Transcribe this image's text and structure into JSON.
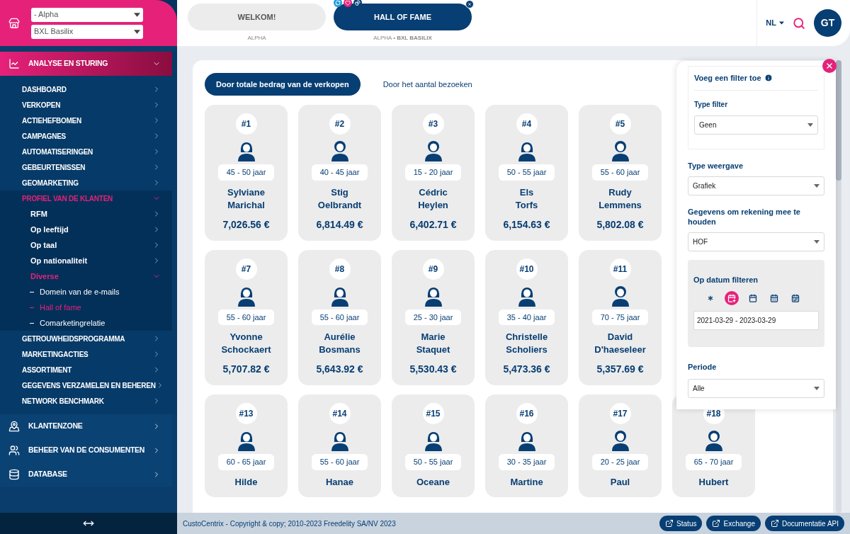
{
  "sidebar": {
    "selects": [
      "- Alpha",
      "BXL Basilix"
    ],
    "sections": [
      {
        "label": "ANALYSE EN STURING",
        "kind": "chart",
        "expanded": true,
        "selected": true,
        "items": [
          {
            "label": "DASHBOARD",
            "selected": false,
            "expanded": false
          },
          {
            "label": "VERKOPEN",
            "selected": false,
            "expanded": false
          },
          {
            "label": "ACTIEHEFBOMEN",
            "selected": false,
            "expanded": false
          },
          {
            "label": "CAMPAGNES",
            "selected": false,
            "expanded": false
          },
          {
            "label": "AUTOMATISERINGEN",
            "selected": false,
            "expanded": false
          },
          {
            "label": "GEBEURTENISSEN",
            "selected": false,
            "expanded": false
          },
          {
            "label": "GEOMARKETING",
            "selected": false,
            "expanded": false
          },
          {
            "label": "PROFIEL VAN DE KLANTEN",
            "selected": true,
            "expanded": true,
            "children": [
              {
                "label": "RFM",
                "selected": false,
                "expanded": false
              },
              {
                "label": "Op leeftijd",
                "selected": false,
                "expanded": false
              },
              {
                "label": "Op taal",
                "selected": false,
                "expanded": false
              },
              {
                "label": "Op nationaliteit",
                "selected": false,
                "expanded": false
              },
              {
                "label": "Diverse",
                "selected": true,
                "expanded": true,
                "children": [
                  {
                    "label": "Domein van de e-mails",
                    "selected": false
                  },
                  {
                    "label": "Hall of fame",
                    "selected": true
                  },
                  {
                    "label": "Comarketingrelatie",
                    "selected": false
                  }
                ]
              }
            ]
          },
          {
            "label": "GETROUWHEIDSPROGRAMMA",
            "selected": false,
            "expanded": false
          },
          {
            "label": "MARKETINGACTIES",
            "selected": false,
            "expanded": false
          },
          {
            "label": "ASSORTIMENT",
            "selected": false,
            "expanded": false
          },
          {
            "label": "GEGEVENS VERZAMELEN EN BEHEREN",
            "selected": false,
            "expanded": false
          },
          {
            "label": "NETWORK BENCHMARK",
            "selected": false,
            "expanded": false
          }
        ]
      },
      {
        "label": "KLANTENZONE",
        "kind": "map",
        "expanded": false,
        "selected": false
      },
      {
        "label": "BEHEER VAN DE CONSUMENTEN",
        "kind": "users",
        "expanded": false,
        "selected": false
      },
      {
        "label": "DATABASE",
        "kind": "database",
        "expanded": false,
        "selected": false
      }
    ]
  },
  "tabs": [
    {
      "label": "WELKOM!",
      "subtitle": "ALPHA",
      "selected": false
    },
    {
      "label": "HALL OF FAME",
      "subtitle": "ALPHA • **BXL BASILIX**",
      "selected": true
    }
  ],
  "header": {
    "language": "NL",
    "avatar": "GT"
  },
  "modes": [
    {
      "label": "Door totale bedrag van de verkopen",
      "selected": true
    },
    {
      "label": "Door het aantal bezoeken",
      "selected": false
    }
  ],
  "card_rows": [
    [
      {
        "rank": "#1",
        "kind": "female",
        "age": "45 - 50 jaar",
        "first": "Sylviane",
        "last": "Marichal",
        "amount": "7,026.56 €"
      },
      {
        "rank": "#2",
        "kind": "male",
        "age": "40 - 45 jaar",
        "first": "Stig",
        "last": "Oelbrandt",
        "amount": "6,814.49 €"
      },
      {
        "rank": "#3",
        "kind": "male",
        "age": "15 - 20 jaar",
        "first": "Cédric",
        "last": "Heylen",
        "amount": "6,402.71 €"
      },
      {
        "rank": "#4",
        "kind": "female",
        "age": "50 - 55 jaar",
        "first": "Els",
        "last": "Torfs",
        "amount": "6,154.63 €"
      },
      {
        "rank": "#5",
        "kind": "male",
        "age": "55 - 60 jaar",
        "first": "Rudy",
        "last": "Lemmens",
        "amount": "5,802.08 €"
      }
    ],
    [
      {
        "rank": "#7",
        "kind": "female",
        "age": "55 - 60 jaar",
        "first": "Yvonne",
        "last": "Schockaert",
        "amount": "5,707.82 €"
      },
      {
        "rank": "#8",
        "kind": "female",
        "age": "55 - 60 jaar",
        "first": "Aurélie",
        "last": "Bosmans",
        "amount": "5,643.92 €"
      },
      {
        "rank": "#9",
        "kind": "female",
        "age": "25 - 30 jaar",
        "first": "Marie",
        "last": "Staquet",
        "amount": "5,530.43 €"
      },
      {
        "rank": "#10",
        "kind": "female",
        "age": "35 - 40 jaar",
        "first": "Christelle",
        "last": "Scholiers",
        "amount": "5,473.36 €"
      },
      {
        "rank": "#11",
        "kind": "male",
        "age": "70 - 75 jaar",
        "first": "David",
        "last": "D'haeseleer",
        "amount": "5,357.69 €"
      }
    ],
    [
      {
        "rank": "#13",
        "kind": "female",
        "age": "60 - 65 jaar",
        "first": "Hilde"
      },
      {
        "rank": "#14",
        "kind": "female",
        "age": "55 - 60 jaar",
        "first": "Hanae"
      },
      {
        "rank": "#15",
        "kind": "female",
        "age": "50 - 55 jaar",
        "first": "Oceane"
      },
      {
        "rank": "#16",
        "kind": "female",
        "age": "30 - 35 jaar",
        "first": "Martine"
      },
      {
        "rank": "#17",
        "kind": "male",
        "age": "20 - 25 jaar",
        "first": "Paul"
      },
      {
        "rank": "#18",
        "kind": "male",
        "age": "65 - 70 jaar",
        "first": "Hubert"
      }
    ]
  ],
  "filter_panel": {
    "title": "Voeg een filter toe",
    "type_filter": {
      "label": "Type filter",
      "value": "Geen"
    },
    "selects": [
      {
        "label": "Type weergave",
        "value": "Grafiek"
      },
      {
        "label": "Gegevens om rekening mee te houden",
        "value": "HOF"
      }
    ],
    "date_filter": {
      "label": "Op datum filteren",
      "modes": [
        {
          "kind": "asterisk",
          "selected": false
        },
        {
          "kind": "calendar-plus",
          "selected": true
        },
        {
          "kind": "calendar",
          "selected": false
        },
        {
          "kind": "calendar-grid",
          "selected": false
        },
        {
          "kind": "calendar-range",
          "selected": false
        }
      ],
      "value": "2021-03-29 - 2023-03-29"
    },
    "period": {
      "label": "Periode",
      "value": "Alle"
    }
  },
  "footer": {
    "copyright": "CustoCentrix - Copyright & copy; 2010-2023 Freedelity SA/NV 2023",
    "links": [
      "Status",
      "Exchange",
      "Documentatie API"
    ]
  }
}
